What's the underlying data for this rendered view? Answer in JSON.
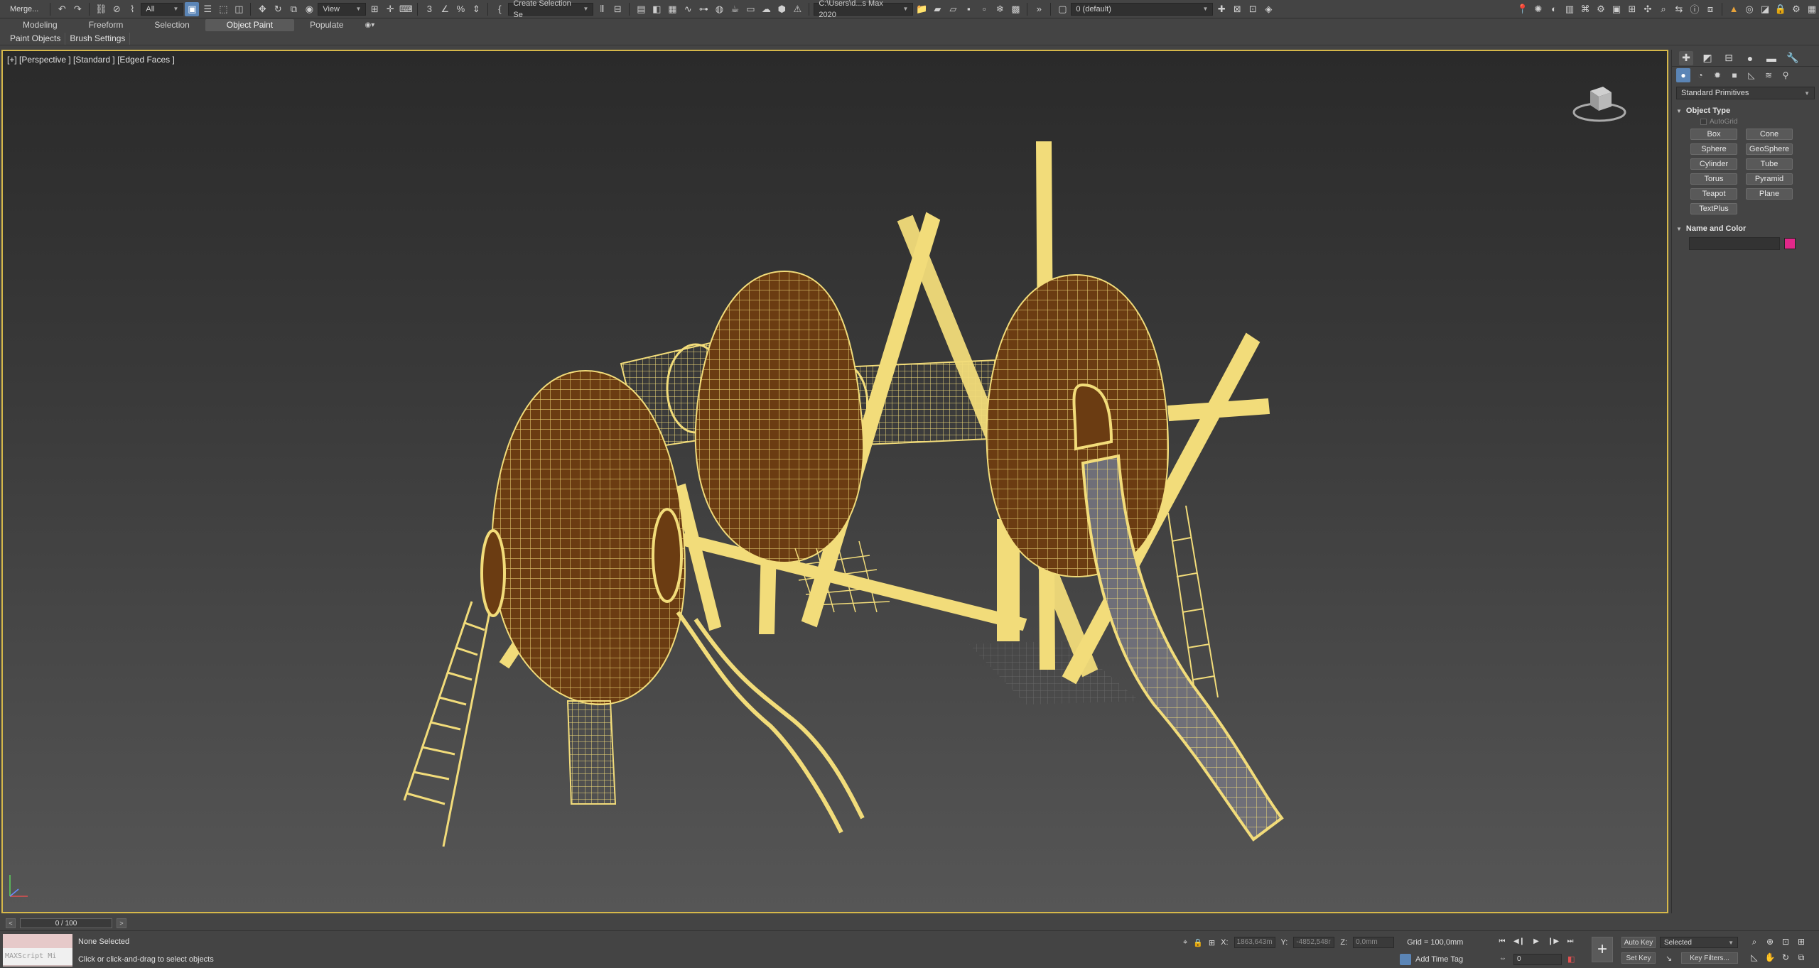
{
  "toolbar": {
    "merge_label": "Merge...",
    "filter_dropdown": "All",
    "refcoord_dropdown": "View",
    "selection_set_dropdown": "Create Selection Se",
    "project_path": "C:\\Users\\d...s Max 2020",
    "layer_dropdown": "0 (default)"
  },
  "ribbon": {
    "tabs": [
      "Modeling",
      "Freeform",
      "Selection",
      "Object Paint",
      "Populate"
    ],
    "active_tab": "Object Paint"
  },
  "subribbon": {
    "paint_objects": "Paint Objects",
    "brush_settings": "Brush Settings"
  },
  "viewport": {
    "label": "[+] [Perspective ] [Standard ] [Edged Faces ]",
    "border_color": "#d6b84a",
    "wire_color": "#f2dc7a",
    "pod_color": "#6b3c12"
  },
  "command_panel": {
    "dropdown": "Standard Primitives",
    "object_type_title": "Object Type",
    "autogrid_label": "AutoGrid",
    "primitives": [
      "Box",
      "Cone",
      "Sphere",
      "GeoSphere",
      "Cylinder",
      "Tube",
      "Torus",
      "Pyramid",
      "Teapot",
      "Plane",
      "TextPlus"
    ],
    "name_color_title": "Name and Color",
    "object_color": "#e2288a"
  },
  "timeline": {
    "slider_label": "0 / 100"
  },
  "status": {
    "maxscript_label": "MAXScript Mi",
    "selection_text": "None Selected",
    "prompt_text": "Click or click-and-drag to select objects",
    "x_label": "X:",
    "x_value": "1863,643m",
    "y_label": "Y:",
    "y_value": "-4852,548r",
    "z_label": "Z:",
    "z_value": "0,0mm",
    "grid_text": "Grid = 100,0mm",
    "add_time_tag": "Add Time Tag",
    "frame_value": "0",
    "auto_key": "Auto Key",
    "set_key": "Set Key",
    "selected_dropdown": "Selected",
    "key_filters": "Key Filters..."
  }
}
